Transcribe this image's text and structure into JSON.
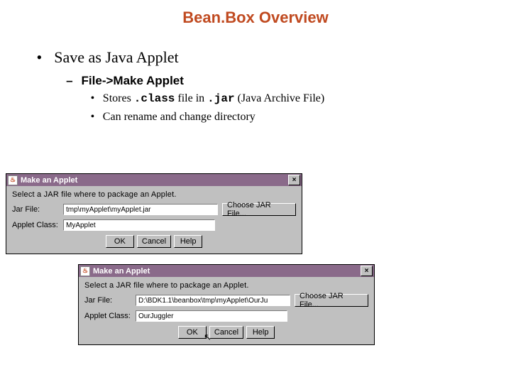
{
  "title": "Bean.Box Overview",
  "bullets": {
    "lvl1": "Save as Java Applet",
    "lvl2": "File->Make Applet",
    "lvl3a_prefix": "Stores ",
    "lvl3a_code1": ".class",
    "lvl3a_mid": " file in ",
    "lvl3a_code2": ".jar",
    "lvl3a_suffix": " (Java Archive File)",
    "lvl3b": "Can rename and change directory"
  },
  "dialog1": {
    "title": "Make an Applet",
    "close": "×",
    "javaicon": "♨",
    "instruction": "Select a JAR file where to package an Applet.",
    "jar_label": "Jar File:",
    "jar_value": "tmp\\myApplet\\myApplet.jar",
    "choose": "Choose JAR File...",
    "class_label": "Applet Class:",
    "class_value": "MyApplet",
    "ok": "OK",
    "cancel": "Cancel",
    "help": "Help"
  },
  "dialog2": {
    "title": "Make an Applet",
    "close": "×",
    "javaicon": "♨",
    "instruction": "Select a JAR file where to package an Applet.",
    "jar_label": "Jar File:",
    "jar_value": "D:\\BDK1.1\\beanbox\\tmp\\myApplet\\OurJu",
    "choose": "Choose JAR File...",
    "class_label": "Applet Class:",
    "class_value": "OurJuggler",
    "ok": "OK",
    "cancel": "Cancel",
    "help": "Help"
  }
}
